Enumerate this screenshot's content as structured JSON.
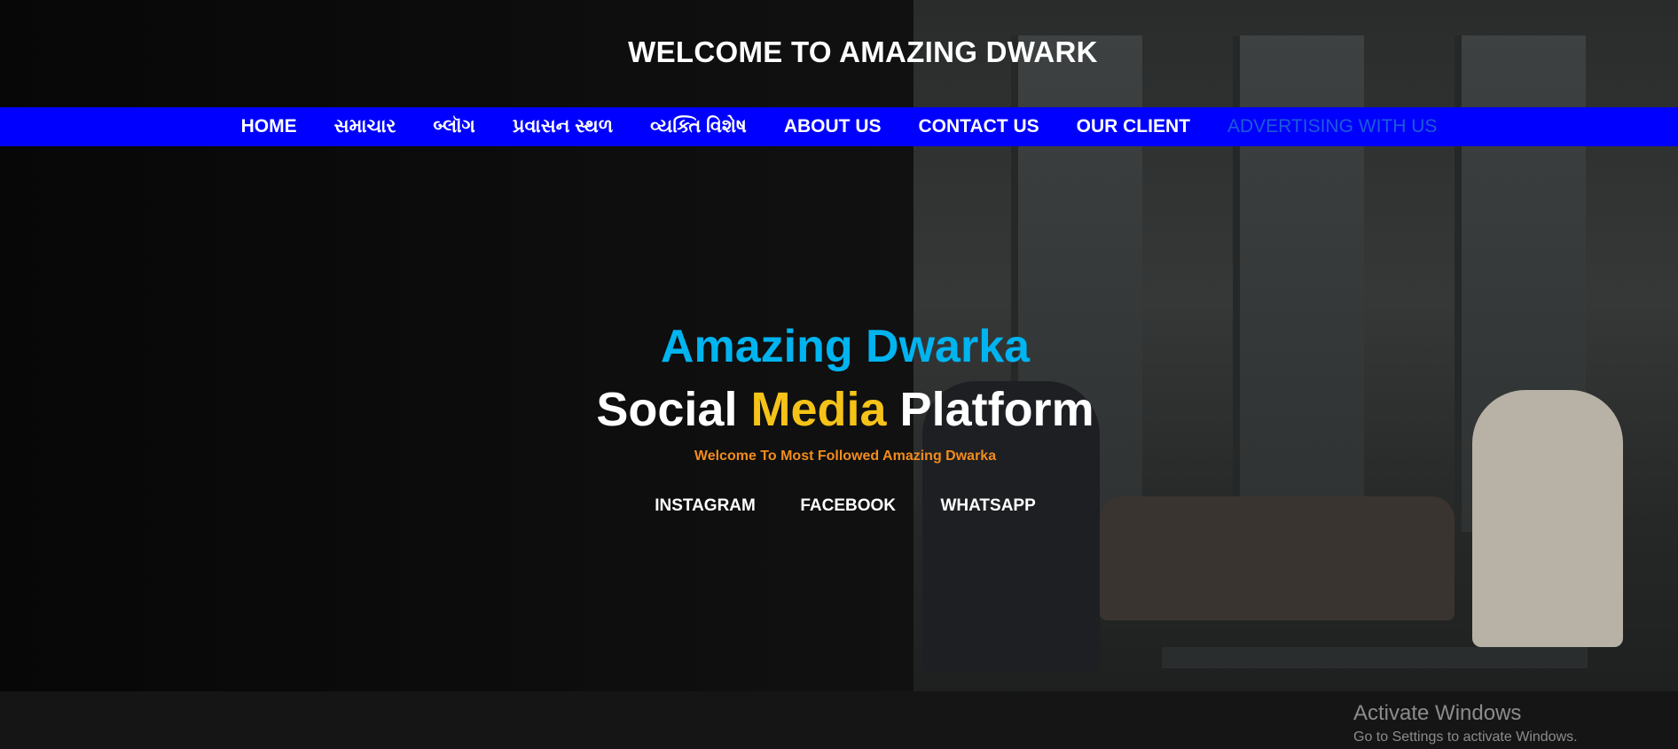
{
  "site": {
    "title": "WELCOME TO AMAZING DWARK"
  },
  "nav": {
    "items": [
      {
        "label": "HOME"
      },
      {
        "label": "સમાચાર"
      },
      {
        "label": "બ્લૉગ"
      },
      {
        "label": "પ્રવાસન સ્થળ"
      },
      {
        "label": "વ્યક્તિ વિશેષ"
      },
      {
        "label": "ABOUT US"
      },
      {
        "label": "CONTACT US"
      },
      {
        "label": "OUR CLIENT"
      },
      {
        "label": "ADVERTISING WITH US"
      }
    ]
  },
  "hero": {
    "title": "Amazing Dwarka",
    "sub_part1": "Social",
    "sub_highlight": "Media",
    "sub_part2": "Platform",
    "tagline": "Welcome To Most Followed Amazing Dwarka"
  },
  "social": {
    "instagram": "INSTAGRAM",
    "facebook": "FACEBOOK",
    "whatsapp": "WHATSAPP"
  },
  "windows_notice": {
    "title": "Activate Windows",
    "subtitle": "Go to Settings to activate Windows."
  },
  "colors": {
    "navbar": "#0000ff",
    "hero_title": "#00b4f0",
    "highlight": "#f5c218",
    "tagline": "#f28c1d",
    "active_nav": "#1e5bd6"
  }
}
